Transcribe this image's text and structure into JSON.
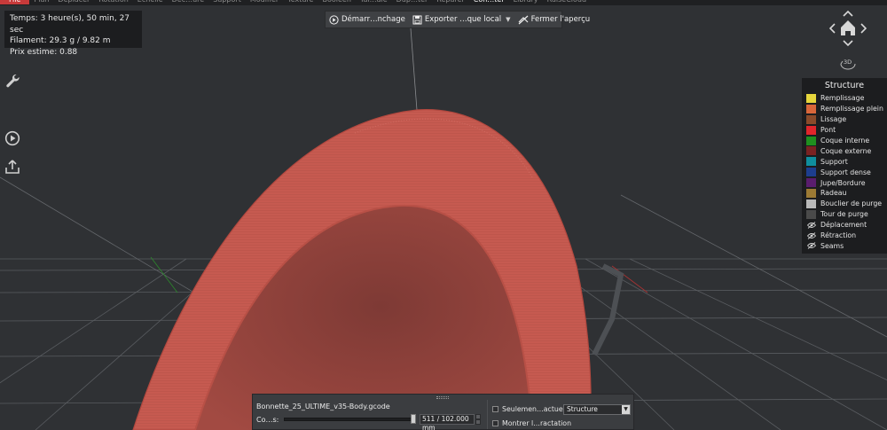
{
  "menu": {
    "items": [
      "File",
      "Plan",
      "Déplacer",
      "Rotation",
      "Échelle",
      "Déc…ure",
      "Support",
      "Modifier",
      "Texture",
      "Booléen",
      "Tai…ale",
      "Dup…ter",
      "Réparer",
      "Con…ter",
      "Library",
      "RaiseCloud"
    ],
    "active_index": 13
  },
  "stats": {
    "time": "Temps: 3 heure(s), 50 min, 27 sec",
    "filament": "Filament: 29.3 g / 9.82 m",
    "price": "Prix estime: 0.88"
  },
  "preview_toolbar": {
    "start_label": "Démarr…nchage",
    "export_label": "Exporter …que local",
    "close_label": "Fermer l'aperçu"
  },
  "nav": {
    "view_3d_label": "3D"
  },
  "legend": {
    "title": "Structure",
    "items": [
      {
        "label": "Remplissage",
        "color": "#e6d63c"
      },
      {
        "label": "Remplissage plein",
        "color": "#d9663a"
      },
      {
        "label": "Lissage",
        "color": "#8a4a2a"
      },
      {
        "label": "Pont",
        "color": "#e0252b"
      },
      {
        "label": "Coque interne",
        "color": "#1f8f1f"
      },
      {
        "label": "Coque externe",
        "color": "#7a2222"
      },
      {
        "label": "Support",
        "color": "#0f8e9e"
      },
      {
        "label": "Support dense",
        "color": "#1d3e8f"
      },
      {
        "label": "Jupe/Bordure",
        "color": "#5a1d6e"
      },
      {
        "label": "Radeau",
        "color": "#9c7a34"
      },
      {
        "label": "Bouclier de purge",
        "color": "#b8b8b8"
      },
      {
        "label": "Tour de purge",
        "color": "#4a4a4a"
      }
    ],
    "toggles": [
      "Déplacement",
      "Rétraction",
      "Seams"
    ]
  },
  "bottom_panel": {
    "file_name": "Bonnette_25_ULTIME_v35-Body.gcode",
    "layer_label": "Co…s:",
    "layer_value": "511 / 102.000 mm",
    "only_current_label": "Seulemen…actuelle",
    "show_retraction_label": "Montrer l…ractation",
    "view_mode": "Structure"
  },
  "colors": {
    "model": "#c2584f",
    "model_dark": "#8f3c36",
    "background": "#2f3134",
    "grid": "#5a5d61"
  }
}
